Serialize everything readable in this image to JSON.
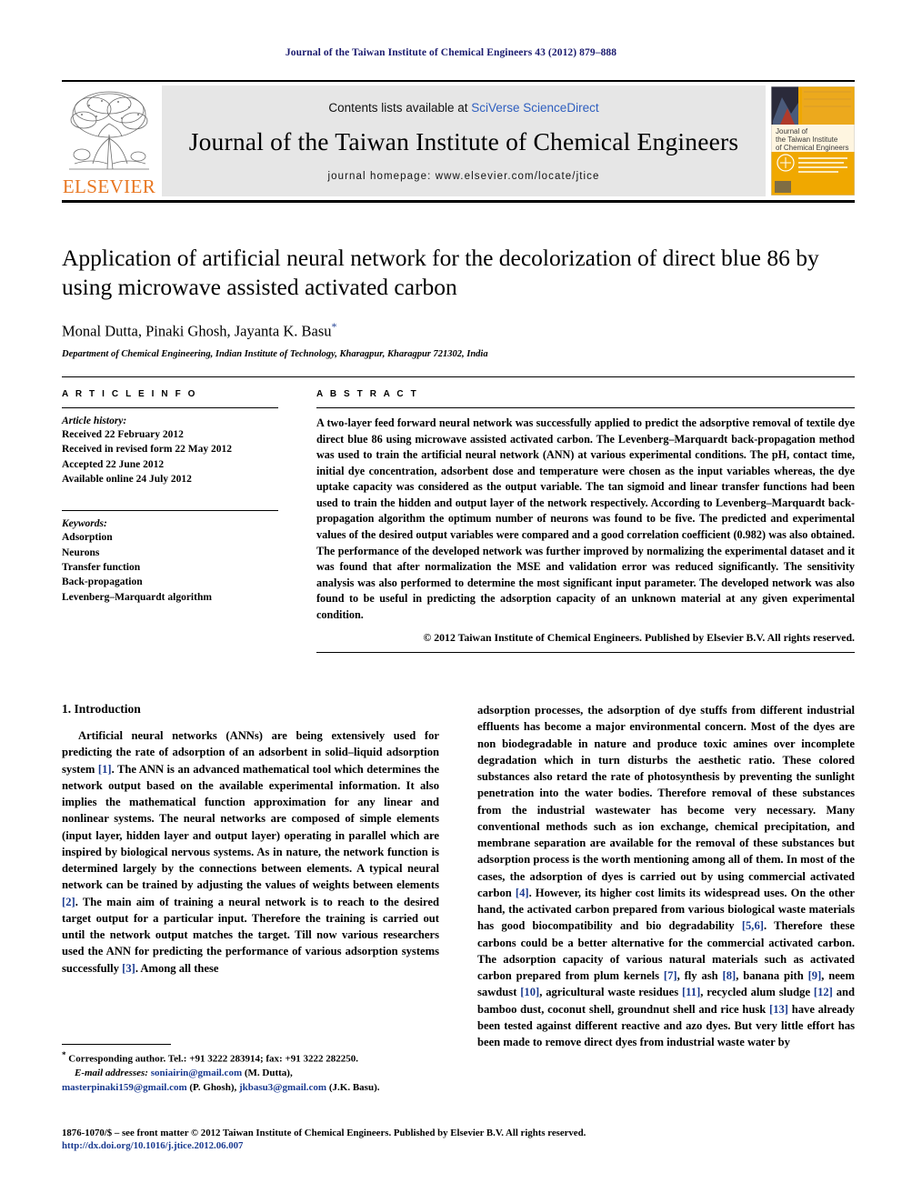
{
  "running_head": "Journal of the Taiwan Institute of Chemical Engineers 43 (2012) 879–888",
  "masthead": {
    "publisher_wordmark": "ELSEVIER",
    "contents_prefix": "Contents lists available at ",
    "contents_link": "SciVerse ScienceDirect",
    "journal_title": "Journal of the Taiwan Institute of Chemical Engineers",
    "homepage_line": "journal homepage: www.elsevier.com/locate/jtice",
    "cover": {
      "line1": "Journal of",
      "line2": "the Taiwan Institute",
      "line3": "of Chemical Engineers"
    }
  },
  "article": {
    "title": "Application of artificial neural network for the decolorization of direct blue 86 by using microwave assisted activated carbon",
    "authors": "Monal Dutta, Pinaki Ghosh, Jayanta K. Basu",
    "corresponding_marker": "*",
    "affiliation": "Department of Chemical Engineering, Indian Institute of Technology, Kharagpur, Kharagpur 721302, India"
  },
  "article_info": {
    "heading": "A R T I C L E   I N F O",
    "history_label": "Article history:",
    "history": [
      "Received 22 February 2012",
      "Received in revised form 22 May 2012",
      "Accepted 22 June 2012",
      "Available online 24 July 2012"
    ],
    "keywords_label": "Keywords:",
    "keywords": [
      "Adsorption",
      "Neurons",
      "Transfer function",
      "Back-propagation",
      "Levenberg–Marquardt algorithm"
    ]
  },
  "abstract": {
    "heading": "A B S T R A C T",
    "text": "A two-layer feed forward neural network was successfully applied to predict the adsorptive removal of textile dye direct blue 86 using microwave assisted activated carbon. The Levenberg–Marquardt back-propagation method was used to train the artificial neural network (ANN) at various experimental conditions. The pH, contact time, initial dye concentration, adsorbent dose and temperature were chosen as the input variables whereas, the dye uptake capacity was considered as the output variable. The tan sigmoid and linear transfer functions had been used to train the hidden and output layer of the network respectively. According to Levenberg–Marquardt back-propagation algorithm the optimum number of neurons was found to be five. The predicted and experimental values of the desired output variables were compared and a good correlation coefficient (0.982) was also obtained. The performance of the developed network was further improved by normalizing the experimental dataset and it was found that after normalization the MSE and validation error was reduced significantly. The sensitivity analysis was also performed to determine the most significant input parameter. The developed network was also found to be useful in predicting the adsorption capacity of an unknown material at any given experimental condition.",
    "copyright": "© 2012 Taiwan Institute of Chemical Engineers. Published by Elsevier B.V. All rights reserved."
  },
  "body": {
    "section_heading": "1. Introduction",
    "left_paragraph_part1": "Artificial neural networks (ANNs) are being extensively used for predicting the rate of adsorption of an adsorbent in solid–liquid adsorption system ",
    "ref1": "[1]",
    "left_paragraph_part2": ". The ANN is an advanced mathematical tool which determines the network output based on the available experimental information. It also implies the mathematical function approximation for any linear and nonlinear systems. The neural networks are composed of simple elements (input layer, hidden layer and output layer) operating in parallel which are inspired by biological nervous systems. As in nature, the network function is determined largely by the connections between elements. A typical neural network can be trained by adjusting the values of weights between elements ",
    "ref2": "[2]",
    "left_paragraph_part3": ". The main aim of training a neural network is to reach to the desired target output for a particular input. Therefore the training is carried out until the network output matches the target. Till now various researchers used the ANN for predicting the performance of various adsorption systems successfully ",
    "ref3": "[3]",
    "left_paragraph_part4": ". Among all these",
    "right_part1": "adsorption processes, the adsorption of dye stuffs from different industrial effluents has become a major environmental concern. Most of the dyes are non biodegradable in nature and produce toxic amines over incomplete degradation which in turn disturbs the aesthetic ratio. These colored substances also retard the rate of photosynthesis by preventing the sunlight penetration into the water bodies. Therefore removal of these substances from the industrial wastewater has become very necessary. Many conventional methods such as ion exchange, chemical precipitation, and membrane separation are available for the removal of these substances but adsorption process is the worth mentioning among all of them. In most of the cases, the adsorption of dyes is carried out by using commercial activated carbon ",
    "ref4": "[4]",
    "right_part2": ". However, its higher cost limits its widespread uses. On the other hand, the activated carbon prepared from various biological waste materials has good biocompatibility and bio degradability ",
    "ref56": "[5,6]",
    "right_part3": ". Therefore these carbons could be a better alternative for the commercial activated carbon. The adsorption capacity of various natural materials such as activated carbon prepared from plum kernels ",
    "ref7": "[7]",
    "right_part4": ", fly ash ",
    "ref8": "[8]",
    "right_part5": ", banana pith ",
    "ref9": "[9]",
    "right_part6": ", neem sawdust ",
    "ref10": "[10]",
    "right_part7": ", agricultural waste residues ",
    "ref11": "[11]",
    "right_part8": ", recycled alum sludge ",
    "ref12": "[12]",
    "right_part9": " and bamboo dust, coconut shell, groundnut shell and rice husk ",
    "ref13": "[13]",
    "right_part10": " have already been tested against different reactive and azo dyes. But very little effort has been made to remove direct dyes from industrial waste water by"
  },
  "footnote": {
    "marker": "*",
    "corresponding": " Corresponding author. Tel.: +91 3222 283914; fax: +91 3222 282250.",
    "email_label": "E-mail addresses:",
    "email1": "soniairin@gmail.com",
    "email1_owner": " (M. Dutta),",
    "email2": "masterpinaki159@gmail.com",
    "email2_owner": " (P. Ghosh), ",
    "email3": "jkbasu3@gmail.com",
    "email3_owner": " (J.K. Basu)."
  },
  "bottom": {
    "front_matter": "1876-1070/$ – see front matter © 2012 Taiwan Institute of Chemical Engineers. Published by Elsevier B.V. All rights reserved.",
    "doi": "http://dx.doi.org/10.1016/j.jtice.2012.06.007"
  },
  "colors": {
    "elsevier_orange": "#E87722",
    "link_blue": "#1a3a8f",
    "sciencedirect_blue": "#2f5fbf",
    "masthead_gray": "#e6e6e6",
    "cover_orange": "#F0A800"
  }
}
